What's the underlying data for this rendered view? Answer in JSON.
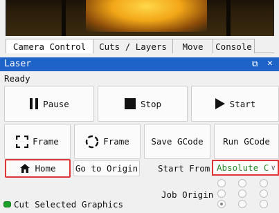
{
  "tabs": [
    {
      "label": "Camera Control",
      "active": true
    },
    {
      "label": "Cuts / Layers",
      "active": false
    },
    {
      "label": "Move",
      "active": false
    },
    {
      "label": "Console",
      "active": false
    }
  ],
  "laser_panel": {
    "title": "Laser",
    "status": "Ready",
    "buttons": {
      "pause": "Pause",
      "stop": "Stop",
      "start": "Start",
      "frame_rect": "Frame",
      "frame_circle": "Frame",
      "save_gcode": "Save GCode",
      "run_gcode": "Run GCode",
      "home": "Home",
      "go_to_origin": "Go to Origin"
    },
    "start_from_label": "Start From:",
    "start_from_value": "Absolute C",
    "job_origin_label": "Job Origin",
    "job_origin_selected": "bottom-left",
    "cut_selected_label": "Cut Selected Graphics",
    "cut_selected_checked": true
  },
  "colors": {
    "title_bar": "#1e64c8",
    "highlight_border": "#e03434",
    "select_text": "#2a8a2a",
    "checkbox": "#1fa02a"
  }
}
